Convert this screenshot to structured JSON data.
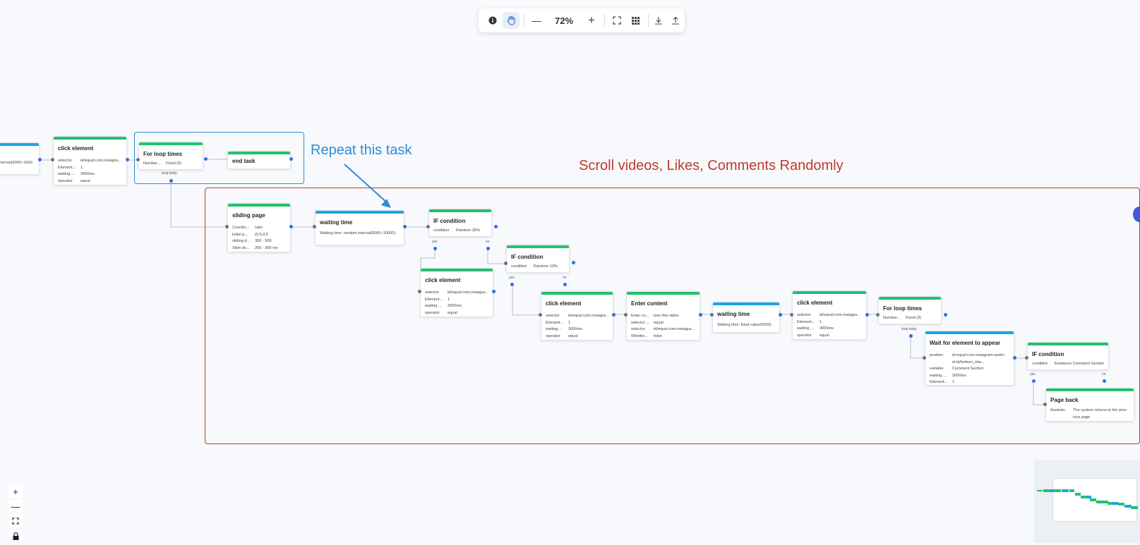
{
  "toolbar": {
    "info_icon": "info-icon",
    "hand_icon": "hand-pan-icon",
    "zoom_out_label": "—",
    "zoom_level": "72%",
    "zoom_in_label": "+",
    "fit_icon": "fit-view-icon",
    "grid_icon": "grid-icon",
    "download_icon": "download-icon",
    "upload_icon": "upload-icon"
  },
  "annotations": {
    "repeat_label": "Repeat this task",
    "scroll_label": "Scroll videos, Likes, Comments Randomly",
    "repeat_color": "#2c8cd6",
    "scroll_color": "#c0392b"
  },
  "nodes": {
    "n0": {
      "rows": [
        {
          "v": "nterval(5000~1000"
        }
      ]
    },
    "n1": {
      "title": "click element",
      "rows": [
        {
          "k": "selector",
          "v": "id/equal:com.instagra..."
        },
        {
          "k": "Element...",
          "v": "1"
        },
        {
          "k": "waiting ...",
          "v": "3000ms"
        },
        {
          "k": "operator",
          "v": "equal"
        }
      ]
    },
    "n2": {
      "title": "For loop times",
      "rows": [
        {
          "k": "Number ...",
          "v": "Fixed (5)"
        }
      ],
      "loop_label": "loop body"
    },
    "n3": {
      "title": "end task"
    },
    "n4": {
      "title": "sliding page",
      "rows": [
        {
          "k": "Coordin...",
          "v": "ratio"
        },
        {
          "k": "initial p...",
          "v": "(0.5,0.5"
        },
        {
          "k": "sliding d...",
          "v": "300 - 500"
        },
        {
          "k": "Slide du...",
          "v": "200 - 300 ms"
        }
      ]
    },
    "n5": {
      "title": "waiting time",
      "note": "Waiting time: random interval(5000~10000)"
    },
    "n6": {
      "title": "IF condition",
      "rows": [
        {
          "k": "condition",
          "v": "Random 30%"
        }
      ],
      "yes": "yes",
      "no": "no"
    },
    "n7": {
      "title": "click element",
      "rows": [
        {
          "k": "selector",
          "v": "id/equal:com.instagra..."
        },
        {
          "k": "Element...",
          "v": "1"
        },
        {
          "k": "waiting ...",
          "v": "3000ms"
        },
        {
          "k": "operator",
          "v": "equal"
        }
      ]
    },
    "n8": {
      "title": "IF condition",
      "rows": [
        {
          "k": "condition",
          "v": "Random 10%"
        }
      ],
      "yes": "yes",
      "no": "no"
    },
    "n9": {
      "title": "click element",
      "rows": [
        {
          "k": "selector",
          "v": "id/equal:com.instagra..."
        },
        {
          "k": "Element...",
          "v": "1"
        },
        {
          "k": "waiting ...",
          "v": "3000ms"
        },
        {
          "k": "operator",
          "v": "equal"
        }
      ]
    },
    "n10": {
      "title": "Enter content",
      "rows": [
        {
          "k": "Enter co...",
          "v": "love this video"
        },
        {
          "k": "selector ...",
          "v": "equal"
        },
        {
          "k": "selector",
          "v": "id/equal:com.instagra..."
        },
        {
          "k": "Whethe...",
          "v": "false"
        }
      ]
    },
    "n11": {
      "title": "waiting time",
      "note": "Waiting time: fixed value(5000)"
    },
    "n12": {
      "title": "click element",
      "rows": [
        {
          "k": "selector",
          "v": "id/equal:com.instagra..."
        },
        {
          "k": "Element...",
          "v": "1"
        },
        {
          "k": "waiting ...",
          "v": "3000ms"
        },
        {
          "k": "operator",
          "v": "equal"
        }
      ]
    },
    "n13": {
      "title": "For loop times",
      "rows": [
        {
          "k": "Number...",
          "v": "Fixed (3)"
        }
      ],
      "loop_label": "loop body"
    },
    "n14": {
      "title": "Wait for element to appear",
      "rows": [
        {
          "k": "position",
          "v": "id:equal:com.instagram.andro"
        },
        {
          "k": "",
          "v": "id:id/bottom_she..."
        },
        {
          "k": "variable",
          "v": "Comment Section"
        },
        {
          "k": "waiting ...",
          "v": "3000ms"
        },
        {
          "k": "Element...",
          "v": "1"
        }
      ]
    },
    "n15": {
      "title": "IF condition",
      "rows": [
        {
          "k": "condition",
          "v": "Existence Comment Section"
        }
      ],
      "yes": "yes",
      "no": "no"
    },
    "n16": {
      "title": "Page back",
      "rows": [
        {
          "k": "illustrate",
          "v": "The system returns to the prev"
        },
        {
          "k": "",
          "v": "ious page"
        }
      ]
    }
  },
  "controls": {
    "zoom_in": "+",
    "zoom_out": "—",
    "fit_icon": "fit-view-icon",
    "lock_icon": "lock-icon"
  },
  "minimap": {
    "label": "minimap"
  },
  "colors": {
    "green": "#25c16f",
    "blue": "#1ea3e6",
    "port_out": "#2f6fe0",
    "port_in": "#6b7280"
  }
}
